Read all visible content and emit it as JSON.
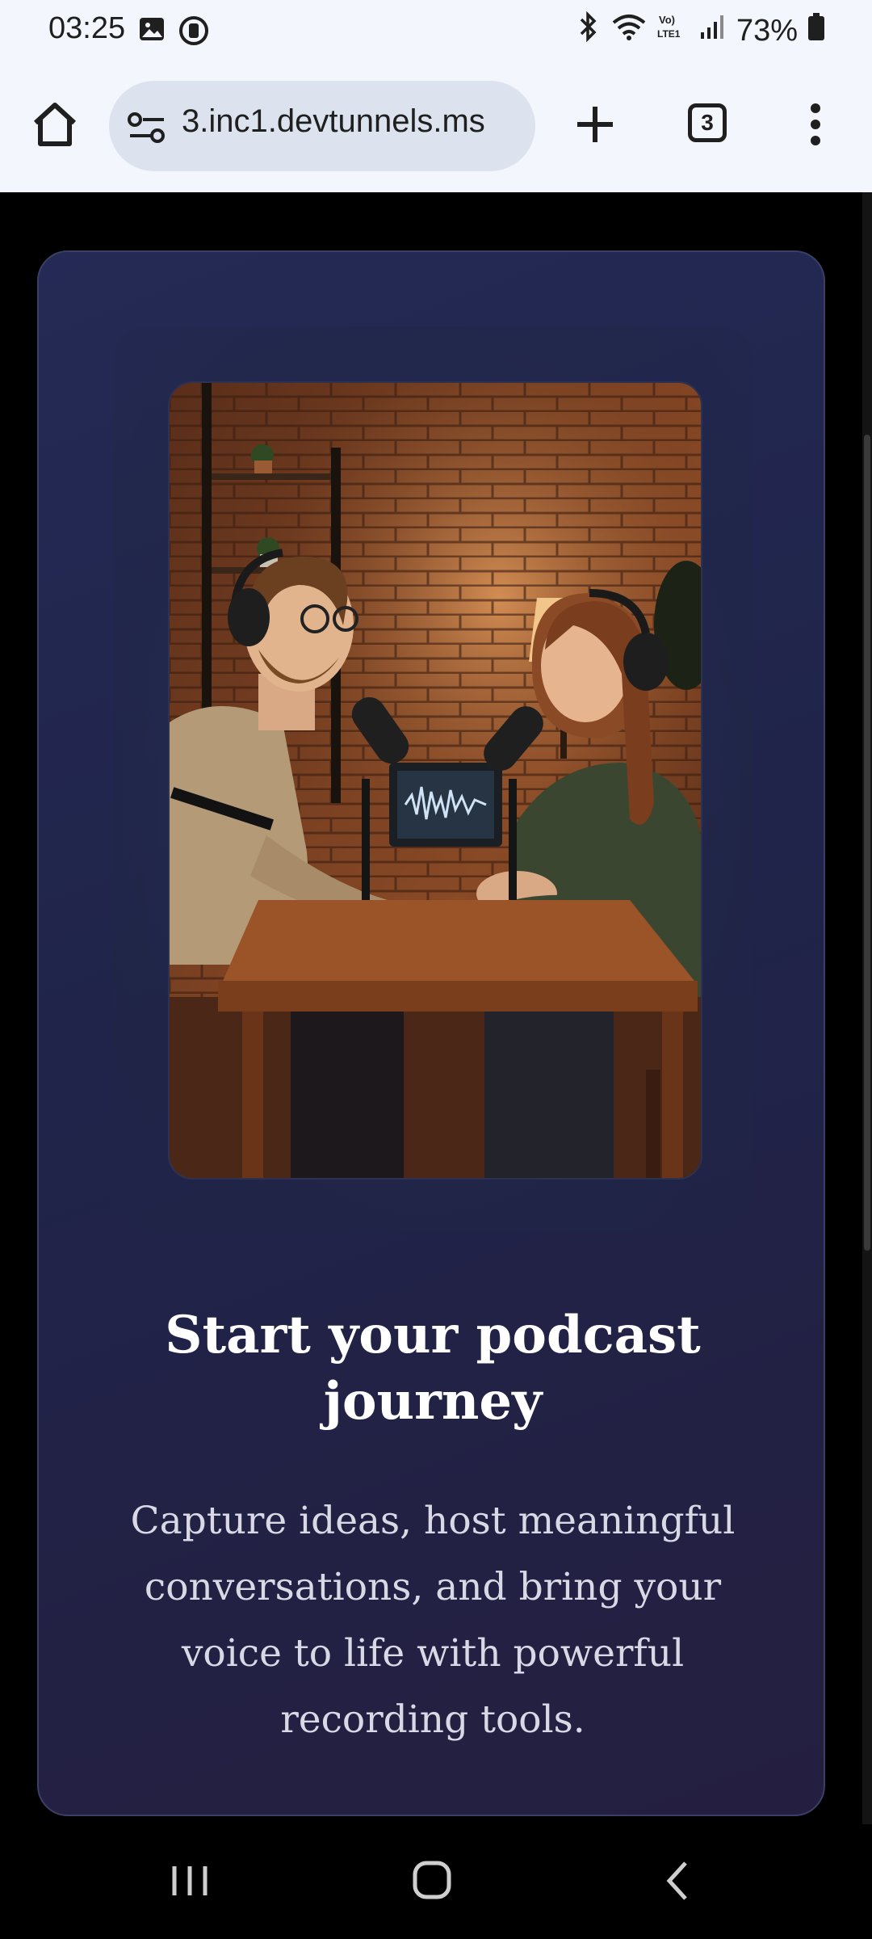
{
  "status_bar": {
    "time": "03:25",
    "battery": "73%",
    "icons": [
      "image-icon",
      "data-saver-icon",
      "bluetooth-icon",
      "wifi-icon",
      "volte-icon",
      "signal-icon",
      "battery-icon"
    ]
  },
  "browser": {
    "url": "3.inc1.devtunnels.ms",
    "tab_count": "3"
  },
  "hero": {
    "title": "Start your podcast journey",
    "description": "Capture ideas, host meaningful conversations, and bring your voice to life with powerful recording tools.",
    "image_alt": "Two podcasters talking into microphones at a wooden table"
  },
  "colors": {
    "card_bg": "#242a55",
    "title": "#ffffff",
    "text": "#d9d9e6"
  }
}
